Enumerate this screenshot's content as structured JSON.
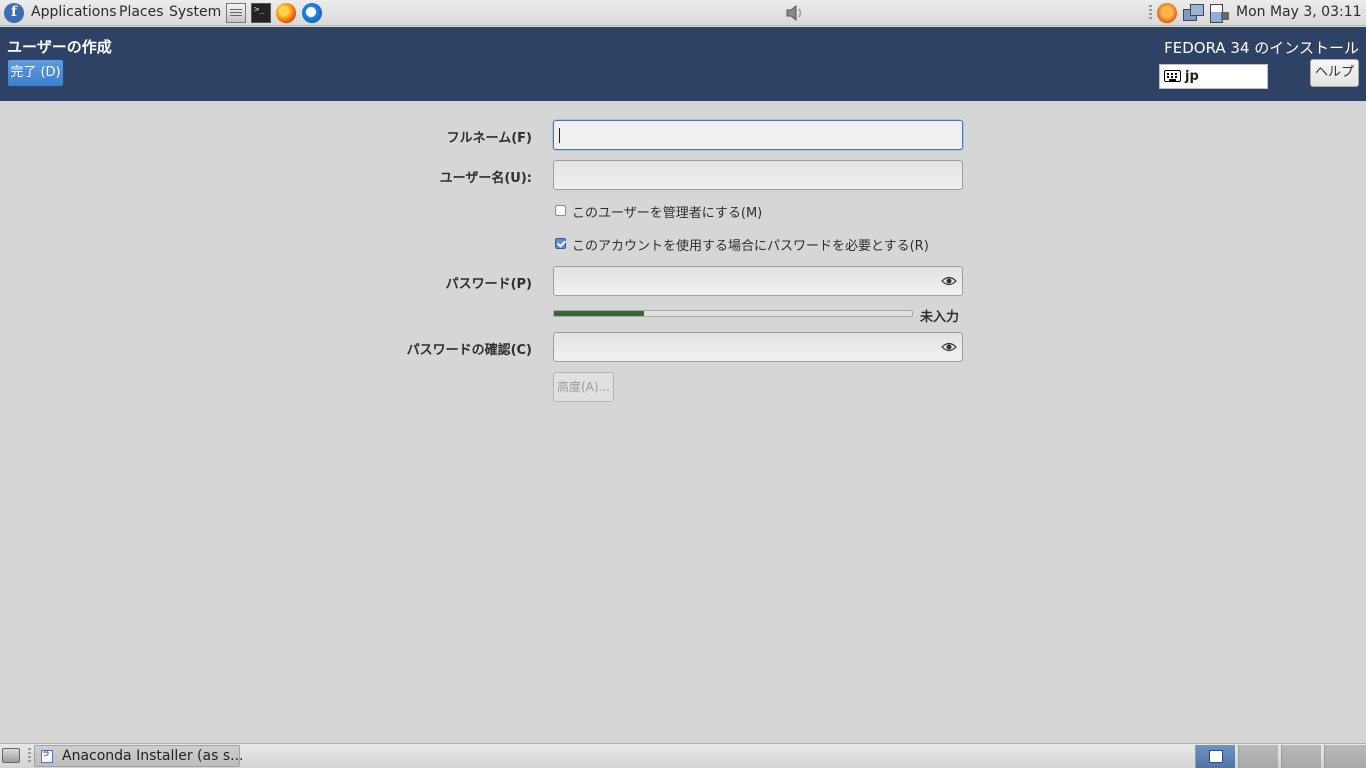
{
  "top_panel": {
    "menus": [
      "Applications",
      "Places",
      "System"
    ],
    "clock": "Mon May  3, 03:11"
  },
  "header": {
    "title": "ユーザーの作成",
    "done_label": "完了 (D)",
    "product": "FEDORA 34 のインストール",
    "keyboard_layout": "jp",
    "help_label": "ヘルプ"
  },
  "form": {
    "fullname_label": "フルネーム(F)",
    "fullname_value": "",
    "username_label": "ユーザー名(U):",
    "username_value": "",
    "admin_checkbox": {
      "label": "このユーザーを管理者にする(M)",
      "checked": false
    },
    "require_password_checkbox": {
      "label": "このアカウントを使用する場合にパスワードを必要とする(R)",
      "checked": true
    },
    "password_label": "パスワード(P)",
    "password_value": "",
    "strength_fraction": 0.25,
    "strength_label": "未入力",
    "confirm_label": "パスワードの確認(C)",
    "confirm_value": "",
    "advanced_label": "高度(A)..."
  },
  "taskbar": {
    "task_label": "Anaconda Installer (as s...",
    "workspaces": 4,
    "active_workspace": 1
  },
  "colors": {
    "header_bg": "#2e4266",
    "done_button": "#4a8ad6",
    "strength_fill": "#2f6b2f",
    "background": "#d6d6d6"
  },
  "icons": {
    "distro": "fedora-logo-icon",
    "password_reveal": "eye-icon",
    "keyboard": "keyboard-icon"
  }
}
